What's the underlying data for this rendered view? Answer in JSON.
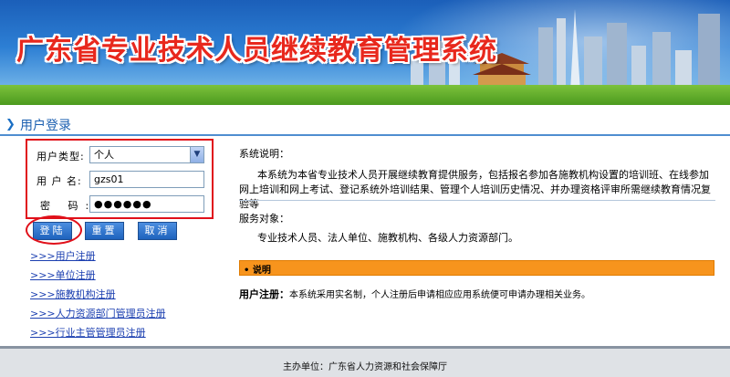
{
  "banner": {
    "title": "广东省专业技术人员继续教育管理系统"
  },
  "section": {
    "title": "用户登录"
  },
  "login": {
    "user_type_label": "用户类型:",
    "user_type_value": "个人",
    "username_label": "用 户 名:",
    "username_value": "gzs01",
    "password_label": "密  码:",
    "password_value": "●●●●●●",
    "login_btn": "登陆",
    "reset_btn": "重置",
    "cancel_btn": "取消"
  },
  "links": [
    ">>>用户注册",
    ">>>单位注册",
    ">>>施教机构注册",
    ">>>人力资源部门管理员注册",
    ">>>行业主管管理员注册"
  ],
  "info": {
    "desc_title": "系统说明：",
    "desc_text": "本系统为本省专业技术人员开展继续教育提供服务，包括报名参加各施教机构设置的培训班、在线参加网上培训和网上考试、登记系统外培训结果、管理个人培训历史情况、并办理资格评审所需继续教育情况复验等",
    "serve_title": "服务对象：",
    "serve_text": "专业技术人员、法人单位、施教机构、各级人力资源部门。",
    "notice_bar": "• 说明",
    "note_label": "用户注册：",
    "note_text": "本系统采用实名制，个人注册后申请相应应用系统便可申请办理相关业务。"
  },
  "footer": {
    "text": "主办单位：广东省人力资源和社会保障厅"
  },
  "colors": {
    "accent": "#1b5fb0",
    "highlight": "#e0101a",
    "notice": "#f7941d",
    "title_red": "#e8281d"
  },
  "icons": {
    "section": "chevron-right-icon",
    "select": "dropdown-arrow-icon"
  }
}
